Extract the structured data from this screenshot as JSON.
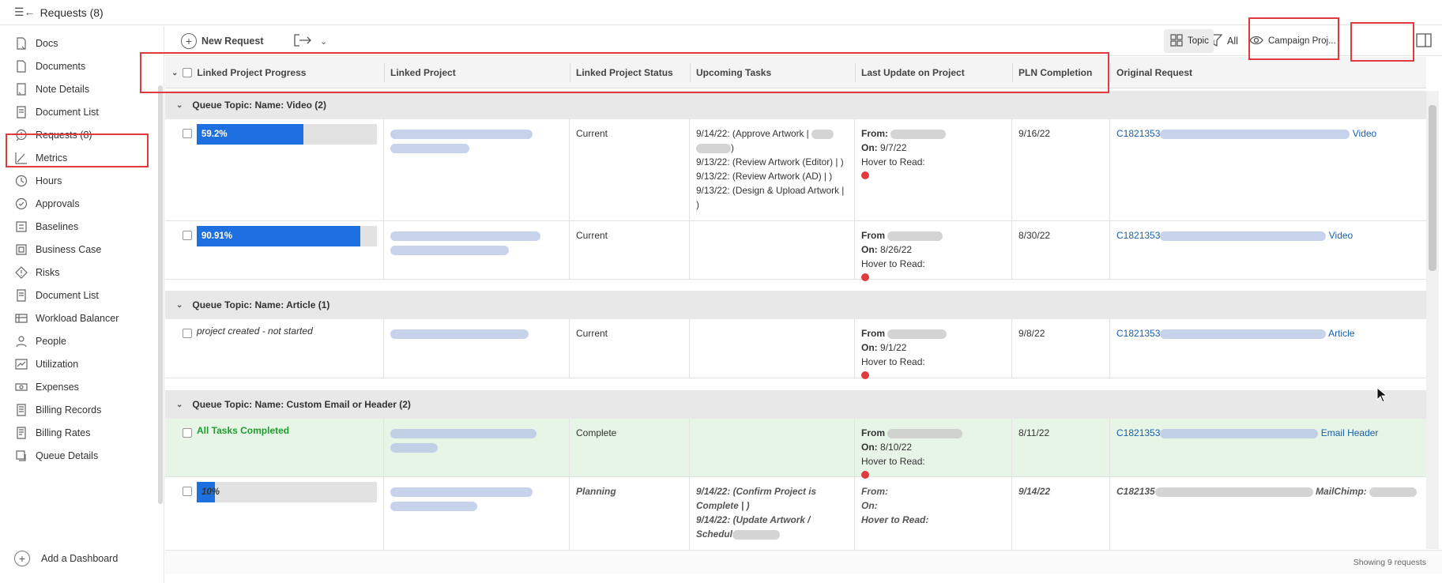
{
  "title": {
    "text": "Requests (8)"
  },
  "sidebar": {
    "items": [
      {
        "label": "Docs",
        "icon": "docs-icon"
      },
      {
        "label": "Documents",
        "icon": "document-icon"
      },
      {
        "label": "Note Details",
        "icon": "note-icon"
      },
      {
        "label": "Document List",
        "icon": "document-list-icon"
      },
      {
        "label": "Requests (8)",
        "icon": "request-icon"
      },
      {
        "label": "Metrics",
        "icon": "metrics-icon"
      },
      {
        "label": "Hours",
        "icon": "clock-icon"
      },
      {
        "label": "Approvals",
        "icon": "approval-icon"
      },
      {
        "label": "Baselines",
        "icon": "baseline-icon"
      },
      {
        "label": "Business Case",
        "icon": "business-case-icon"
      },
      {
        "label": "Risks",
        "icon": "risk-icon"
      },
      {
        "label": "Document List",
        "icon": "document-list-icon"
      },
      {
        "label": "Workload Balancer",
        "icon": "workload-icon"
      },
      {
        "label": "People",
        "icon": "people-icon"
      },
      {
        "label": "Utilization",
        "icon": "utilization-icon"
      },
      {
        "label": "Expenses",
        "icon": "expenses-icon"
      },
      {
        "label": "Billing Records",
        "icon": "billing-icon"
      },
      {
        "label": "Billing Rates",
        "icon": "billing-rates-icon"
      },
      {
        "label": "Queue Details",
        "icon": "queue-icon"
      }
    ],
    "add_dashboard": "Add a Dashboard"
  },
  "toolbar": {
    "new_request": "New Request",
    "filter_label": "All",
    "view_label": "Campaign Proj...",
    "group_label": "Topic"
  },
  "columns": [
    "Linked Project Progress",
    "Linked Project",
    "Linked Project Status",
    "Upcoming Tasks",
    "Last Update on Project",
    "PLN Completion",
    "Original Request"
  ],
  "groups": [
    {
      "label": "Queue Topic: Name: Video (2)"
    },
    {
      "label": "Queue Topic: Name: Article (1)"
    },
    {
      "label": "Queue Topic: Name: Custom Email or Header (2)"
    }
  ],
  "rows": [
    {
      "progress": "59.2%",
      "progress_value": 59.2,
      "status": "Current",
      "tasks": [
        "9/14/22: (Approve Artwork |",
        ")",
        "9/13/22: (Review Artwork (Editor) | )",
        "9/13/22: (Review Artwork (AD) | )",
        "9/13/22: (Design & Upload Artwork |",
        ")"
      ],
      "from": "From:",
      "on": "On: 9/7/22",
      "hover": "Hover to Read:",
      "pln": "9/16/22",
      "req_id": "C1821353",
      "req_type": "Video"
    },
    {
      "progress": "90.91%",
      "progress_value": 90.91,
      "status": "Current",
      "tasks": [],
      "from": "From",
      "on": "On: 8/26/22",
      "hover": "Hover to Read:",
      "pln": "8/30/22",
      "req_id": "C1821353",
      "req_type": "Video"
    },
    {
      "progress": "project created - not started",
      "status": "Current",
      "tasks": [],
      "from": "From",
      "on": "On: 9/1/22",
      "hover": "Hover to Read:",
      "pln": "9/8/22",
      "req_id": "C1821353",
      "req_type": "Article"
    },
    {
      "progress": "All Tasks Completed",
      "status": "Complete",
      "tasks": [],
      "from": "From",
      "on": "On: 8/10/22",
      "hover": "Hover to Read:",
      "pln": "8/11/22",
      "req_id": "C1821353",
      "req_type": "Email Header"
    },
    {
      "progress": "10%",
      "progress_value": 10,
      "status": "Planning",
      "tasks": [
        "9/14/22: (Confirm Project is",
        "Complete | )",
        "9/14/22: (Update Artwork /",
        "Schedul"
      ],
      "from": "From:",
      "on": "On:",
      "hover": "Hover to Read:",
      "pln": "9/14/22",
      "req_id": "C182135",
      "req_type": "MailChimp:"
    }
  ],
  "footer": {
    "text": "Showing 9 requests"
  },
  "colors": {
    "accent": "#1e6fe0",
    "highlight": "#e03a3e",
    "complete_row": "#e6f5e6",
    "link": "#1b5fa8"
  }
}
